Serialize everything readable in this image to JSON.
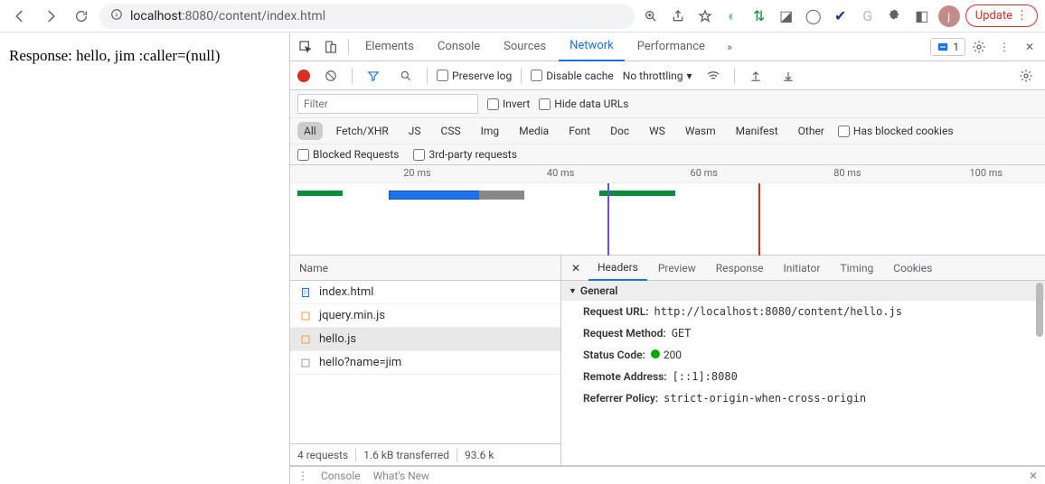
{
  "browser": {
    "url_host": "localhost",
    "url_port": ":8080",
    "url_path": "/content/index.html",
    "avatar_letter": "j",
    "update_label": "Update"
  },
  "page": {
    "content": "Response: hello, jim :caller=(null)"
  },
  "devtools": {
    "tabs": [
      "Elements",
      "Console",
      "Sources",
      "Network",
      "Performance"
    ],
    "active_tab": "Network",
    "issues_count": "1"
  },
  "network": {
    "preserve_log_label": "Preserve log",
    "disable_cache_label": "Disable cache",
    "throttling_label": "No throttling",
    "filter_placeholder": "Filter",
    "invert_label": "Invert",
    "hide_data_urls_label": "Hide data URLs",
    "types": [
      "All",
      "Fetch/XHR",
      "JS",
      "CSS",
      "Img",
      "Media",
      "Font",
      "Doc",
      "WS",
      "Wasm",
      "Manifest",
      "Other"
    ],
    "active_type": "All",
    "has_blocked_cookies_label": "Has blocked cookies",
    "blocked_requests_label": "Blocked Requests",
    "third_party_label": "3rd-party requests",
    "timeline_ticks": [
      "20 ms",
      "40 ms",
      "60 ms",
      "80 ms",
      "100 ms"
    ],
    "name_header": "Name",
    "requests": [
      {
        "name": "index.html",
        "type": "doc"
      },
      {
        "name": "jquery.min.js",
        "type": "js"
      },
      {
        "name": "hello.js",
        "type": "js"
      },
      {
        "name": "hello?name=jim",
        "type": "xhr"
      }
    ],
    "selected_index": 2,
    "status": {
      "count": "4 requests",
      "transferred": "1.6 kB transferred",
      "resources": "93.6 k"
    }
  },
  "detail": {
    "tabs": [
      "Headers",
      "Preview",
      "Response",
      "Initiator",
      "Timing",
      "Cookies"
    ],
    "active_tab": "Headers",
    "section_general": "General",
    "request_url_label": "Request URL:",
    "request_url_value": "http://localhost:8080/content/hello.js",
    "request_method_label": "Request Method:",
    "request_method_value": "GET",
    "status_code_label": "Status Code:",
    "status_code_value": "200",
    "remote_address_label": "Remote Address:",
    "remote_address_value": "[::1]:8080",
    "referrer_policy_label": "Referrer Policy:",
    "referrer_policy_value": "strict-origin-when-cross-origin"
  },
  "drawer": {
    "console_label": "Console",
    "whats_new_label": "What's New"
  }
}
